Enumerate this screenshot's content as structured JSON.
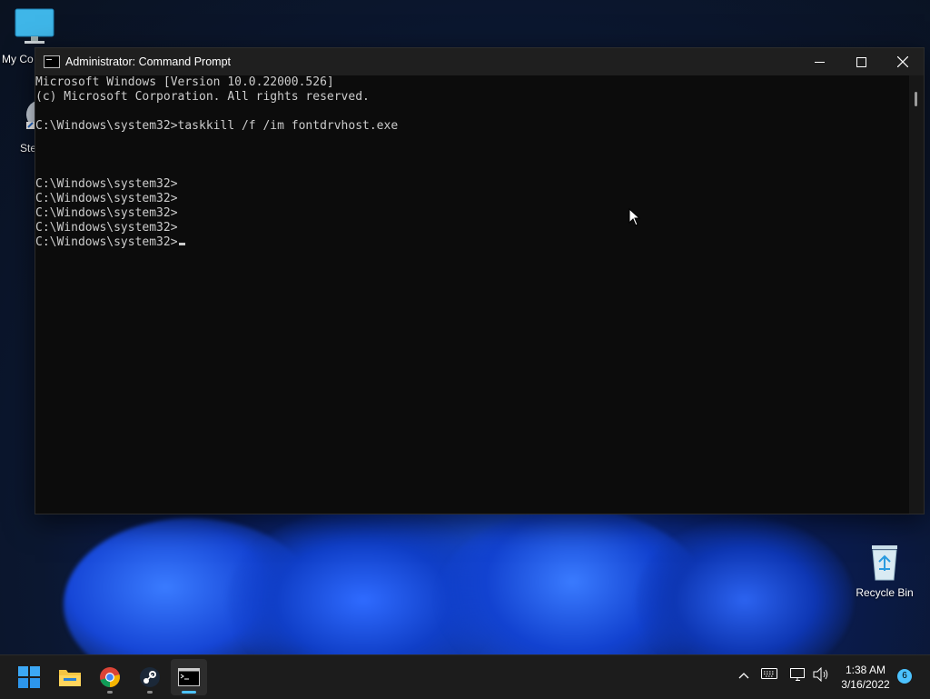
{
  "desktop": {
    "icons": [
      {
        "label": "My Co",
        "icon": "monitor-icon"
      },
      {
        "label": "Ste",
        "icon": "steam-icon"
      },
      {
        "label": "Recycle Bin",
        "icon": "recycle-bin-icon"
      }
    ]
  },
  "window": {
    "title": "Administrator: Command Prompt",
    "icon": "cmd-icon",
    "controls": {
      "minimize": "—",
      "maximize": "☐",
      "close": "✕"
    }
  },
  "console": {
    "lines": [
      "Microsoft Windows [Version 10.0.22000.526]",
      "(c) Microsoft Corporation. All rights reserved.",
      "",
      "C:\\Windows\\system32>taskkill /f /im fontdrvhost.exe",
      "",
      "",
      "",
      "C:\\Windows\\system32>",
      "C:\\Windows\\system32>",
      "C:\\Windows\\system32>",
      "C:\\Windows\\system32>",
      "C:\\Windows\\system32>"
    ]
  },
  "taskbar": {
    "apps": [
      {
        "name": "Start",
        "icon": "windows-start-icon"
      },
      {
        "name": "File Explorer",
        "icon": "folder-icon"
      },
      {
        "name": "Google Chrome",
        "icon": "chrome-icon"
      },
      {
        "name": "Steam",
        "icon": "steam-icon"
      },
      {
        "name": "Command Prompt",
        "icon": "cmd-icon"
      }
    ],
    "tray": {
      "chevron": "^",
      "time": "1:38 AM",
      "date": "3/16/2022",
      "notifications": "6"
    }
  },
  "colors": {
    "console_bg": "#0c0c0c",
    "console_text": "#cccccc",
    "accent": "#4cc2ff"
  }
}
